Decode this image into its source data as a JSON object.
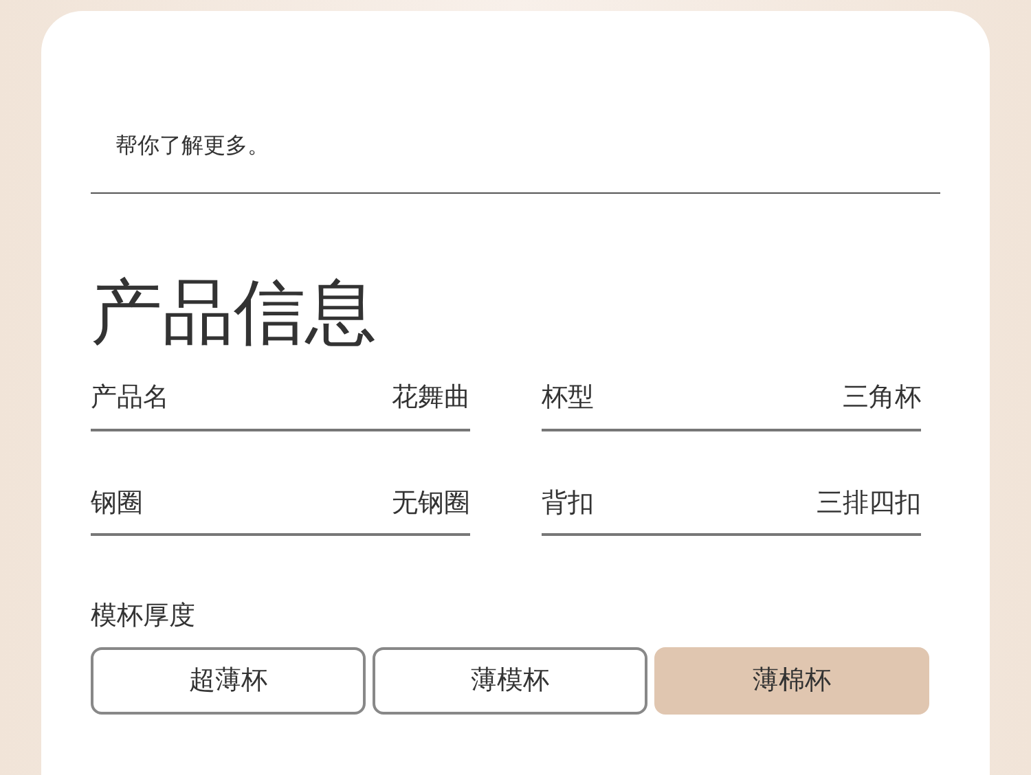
{
  "intro_text": "帮你了解更多。",
  "section_title": "产品信息",
  "specs": [
    {
      "label": "产品名",
      "value": "花舞曲"
    },
    {
      "label": "杯型",
      "value": "三角杯"
    },
    {
      "label": "钢圈",
      "value": "无钢圈"
    },
    {
      "label": "背扣",
      "value": "三排四扣"
    }
  ],
  "cup_thickness": {
    "label": "模杯厚度",
    "options": [
      {
        "label": "超薄杯",
        "selected": false
      },
      {
        "label": "薄模杯",
        "selected": false
      },
      {
        "label": "薄棉杯",
        "selected": true
      }
    ]
  }
}
